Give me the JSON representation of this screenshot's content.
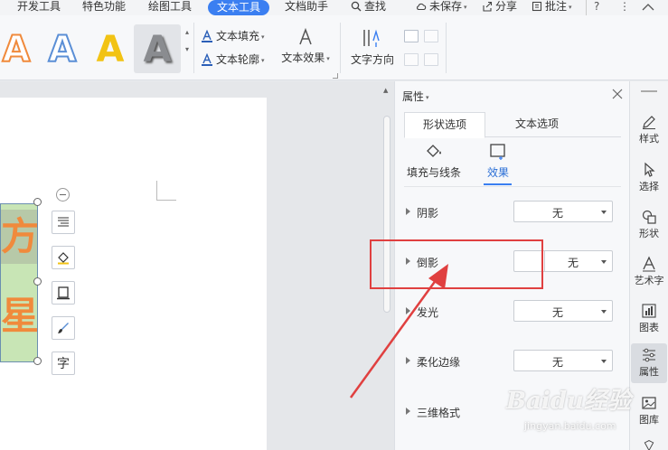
{
  "menu": {
    "items": [
      "开发工具",
      "特色功能",
      "绘图工具",
      "文本工具",
      "文档助手"
    ],
    "search": "查找",
    "unsaved": "未保存",
    "share": "分享",
    "comment": "批注",
    "help": "?",
    "more": "⋮",
    "collapse": "^"
  },
  "ribbon": {
    "art_letters": [
      "A",
      "A",
      "A",
      "A"
    ],
    "text_fill": "文本填充",
    "text_outline": "文本轮廓",
    "text_effect": "文本效果",
    "text_direction": "文字方向",
    "dropdown_caret": "▾"
  },
  "canvas": {
    "char_top": "方",
    "char_bottom": "星"
  },
  "float_toolbar": {
    "char_label": "字"
  },
  "pane": {
    "title": "属性",
    "title_caret": "▾",
    "tabs": [
      "形状选项",
      "文本选项"
    ],
    "sub_tabs": [
      "填充与线条",
      "效果"
    ],
    "rows": [
      {
        "label": "阴影",
        "value": "无"
      },
      {
        "label": "倒影",
        "value": "无"
      },
      {
        "label": "发光",
        "value": "无"
      },
      {
        "label": "柔化边缘",
        "value": "无"
      },
      {
        "label": "三维格式",
        "value": ""
      }
    ]
  },
  "sidebar": {
    "items": [
      "样式",
      "选择",
      "形状",
      "艺术字",
      "图表",
      "属性",
      "图库"
    ]
  },
  "watermark": {
    "main": "Baidu经验",
    "sub": "jingyan.baidu.com"
  },
  "colors": {
    "accent": "#3b7ff1",
    "art_orange": "#f08a3c",
    "art_blue": "#5b8fd6",
    "art_yellow": "#f2c314",
    "highlight": "#e04040",
    "textbox_fill": "#c8e5b5"
  }
}
